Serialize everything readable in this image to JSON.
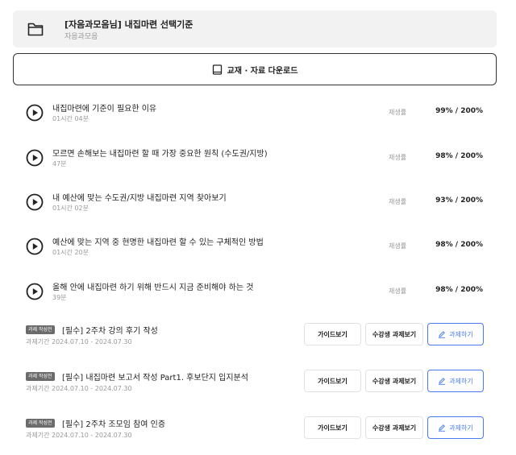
{
  "course": {
    "title": "[자음과모음님] 내집마련 선택기준",
    "subtitle": "자음과모음",
    "icon": "folder-icon"
  },
  "download": {
    "label": "교재 · 자료 다운로드",
    "icon": "book-icon"
  },
  "lessons": [
    {
      "title": "내집마련에 기준이 필요한 이유",
      "duration": "01시간 04분",
      "rate_label": "재생률",
      "rate": "99% / 200%"
    },
    {
      "title": "모르면 손해보는 내집마련 할 때 가장 중요한 원칙 (수도권/지방)",
      "duration": "47분",
      "rate_label": "재생률",
      "rate": "98% / 200%"
    },
    {
      "title": "내 예산에 맞는 수도권/지방 내집마련 지역 찾아보기",
      "duration": "01시간 02분",
      "rate_label": "재생률",
      "rate": "93% / 200%"
    },
    {
      "title": "예산에 맞는 지역 중 현명한 내집마련 할 수 있는 구체적인 방법",
      "duration": "01시간 20분",
      "rate_label": "재생률",
      "rate": "98% / 200%"
    },
    {
      "title": "올해 안에 내집마련 하기 위해 반드시 지금 준비해야 하는 것",
      "duration": "39분",
      "rate_label": "재생률",
      "rate": "98% / 200%"
    }
  ],
  "assignments": [
    {
      "badge": "과제 작성전",
      "title": "[필수] 2주차 강의 후기 작성",
      "period": "과제기간 2024.07.10 - 2024.07.30",
      "guide_label": "가이드보기",
      "peer_label": "수강생 과제보기",
      "do_label": "과제하기"
    },
    {
      "badge": "과제 작성전",
      "title": "[필수] 내집마련 보고서 작성 Part1. 후보단지 입지분석",
      "period": "과제기간 2024.07.10 - 2024.07.30",
      "guide_label": "가이드보기",
      "peer_label": "수강생 과제보기",
      "do_label": "과제하기"
    },
    {
      "badge": "과제 작성전",
      "title": "[필수] 2주차 조모임 참여 인증",
      "period": "과제기간 2024.07.10 - 2024.07.30",
      "guide_label": "가이드보기",
      "peer_label": "수강생 과제보기",
      "do_label": "과제하기"
    }
  ],
  "colors": {
    "accent": "#4a7cf2",
    "header_bg": "#f2f2f2",
    "badge_bg": "#6b6b6b",
    "muted_text": "#999999"
  }
}
